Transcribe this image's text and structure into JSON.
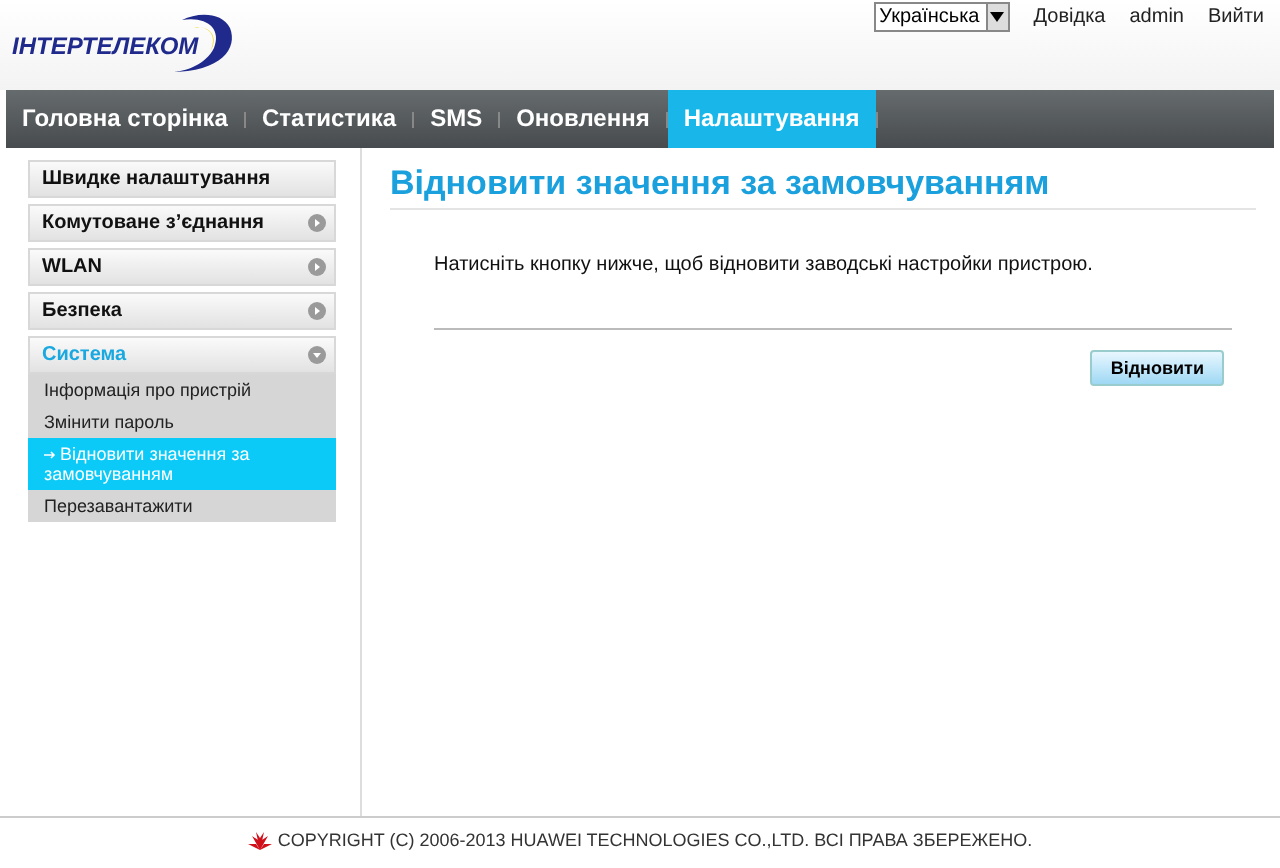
{
  "header": {
    "logo": "ІНТЕРТЕЛЕКОМ",
    "language": "Українська",
    "links": [
      "Довідка",
      "admin",
      "Вийти"
    ]
  },
  "tabs": [
    {
      "label": "Головна сторінка",
      "selected": false
    },
    {
      "label": "Статистика",
      "selected": false
    },
    {
      "label": "SMS",
      "selected": false
    },
    {
      "label": "Оновлення",
      "selected": false
    },
    {
      "label": "Налаштування",
      "selected": true
    }
  ],
  "sidebar": {
    "items": [
      {
        "label": "Швидке налаштування"
      },
      {
        "label": "Комутоване з’єднання",
        "expanded": false
      },
      {
        "label": "WLAN",
        "expanded": false
      },
      {
        "label": "Безпека",
        "expanded": false
      },
      {
        "label": "Система",
        "expanded": true,
        "children": [
          {
            "label": "Інформація про пристрій",
            "selected": false
          },
          {
            "label": "Змінити пароль",
            "selected": false
          },
          {
            "label": "Відновити значення за замовчуванням",
            "selected": true
          },
          {
            "label": "Перезавантажити",
            "selected": false
          }
        ]
      }
    ]
  },
  "content": {
    "title": "Відновити значення за замовчуванням",
    "message": "Натисніть кнопку нижче, щоб відновити заводські настройки пристрою.",
    "button": "Відновити"
  },
  "footer": "COPYRIGHT (C) 2006-2013 HUAWEI TECHNOLOGIES CO.,LTD. ВСІ ПРАВА ЗБЕРЕЖЕНО."
}
